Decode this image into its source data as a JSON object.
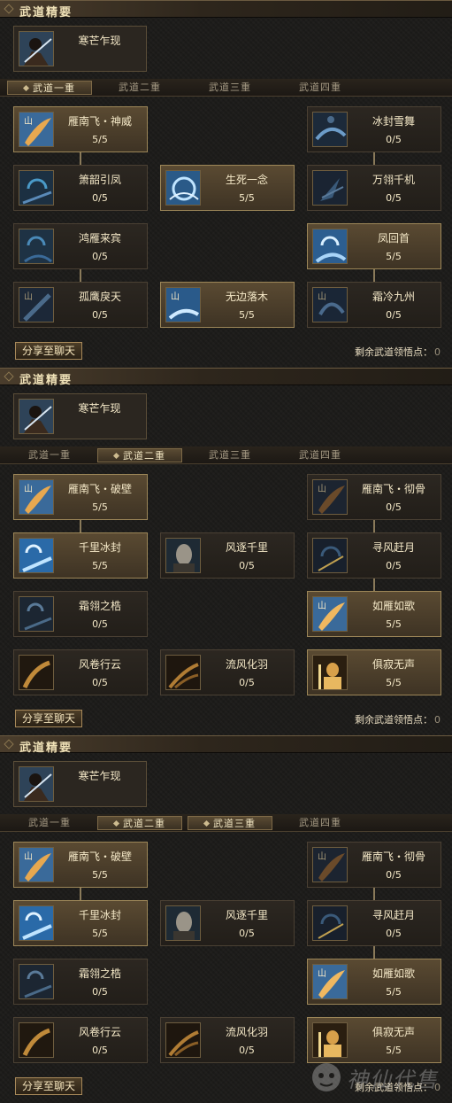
{
  "panels": [
    {
      "section_title": "武道精要",
      "essence": {
        "name": "寒芒乍现",
        "icon": "warrior-portrait-icon"
      },
      "tabs": [
        {
          "label": "武道一重",
          "active": true
        },
        {
          "label": "武道二重",
          "active": false
        },
        {
          "label": "武道三重",
          "active": false
        },
        {
          "label": "武道四重",
          "active": false
        }
      ],
      "skills": [
        {
          "name": "雁南飞・神威",
          "level": "5/5",
          "active": true,
          "icon": "flying-goose-icon"
        },
        {
          "name": "冰封雪舞",
          "level": "0/5",
          "active": false,
          "icon": "ice-storm-icon"
        },
        {
          "name": "箫韶引凤",
          "level": "0/5",
          "active": false,
          "icon": "phoenix-spiral-icon"
        },
        {
          "name": "生死一念",
          "level": "5/5",
          "active": true,
          "icon": "ice-vortex-icon"
        },
        {
          "name": "万翎千机",
          "level": "0/5",
          "active": false,
          "icon": "feather-storm-icon"
        },
        {
          "name": "鸿雁来宾",
          "level": "0/5",
          "active": false,
          "icon": "wild-goose-icon"
        },
        {
          "name": "凤回首",
          "level": "5/5",
          "active": true,
          "icon": "phoenix-return-icon"
        },
        {
          "name": "孤鹰戾天",
          "level": "0/5",
          "active": false,
          "icon": "lone-eagle-icon"
        },
        {
          "name": "无边落木",
          "level": "5/5",
          "active": true,
          "icon": "falling-leaves-icon"
        },
        {
          "name": "霜冷九州",
          "level": "0/5",
          "active": false,
          "icon": "frost-realm-icon"
        }
      ],
      "share_label": "分享至聊天",
      "points_label": "剩余武道领悟点：",
      "points_value": "0"
    },
    {
      "section_title": "武道精要",
      "essence": {
        "name": "寒芒乍现",
        "icon": "warrior-portrait-icon"
      },
      "tabs": [
        {
          "label": "武道一重",
          "active": false
        },
        {
          "label": "武道二重",
          "active": true
        },
        {
          "label": "武道三重",
          "active": false
        },
        {
          "label": "武道四重",
          "active": false
        }
      ],
      "skills": [
        {
          "name": "雁南飞・破壁",
          "level": "5/5",
          "active": true,
          "icon": "flying-goose-icon"
        },
        {
          "name": "雁南飞・彻骨",
          "level": "0/5",
          "active": false,
          "icon": "flying-goose-icon"
        },
        {
          "name": "千里冰封",
          "level": "5/5",
          "active": true,
          "icon": "ice-seal-icon"
        },
        {
          "name": "风逐千里",
          "level": "0/5",
          "active": false,
          "icon": "wind-chaser-portrait-icon"
        },
        {
          "name": "寻风赶月",
          "level": "0/5",
          "active": false,
          "icon": "moon-chase-icon"
        },
        {
          "name": "霜翎之梏",
          "level": "0/5",
          "active": false,
          "icon": "frost-feather-icon"
        },
        {
          "name": "如雁如歌",
          "level": "5/5",
          "active": true,
          "icon": "goose-song-icon"
        },
        {
          "name": "风卷行云",
          "level": "0/5",
          "active": false,
          "icon": "wind-cloud-icon"
        },
        {
          "name": "流风化羽",
          "level": "0/5",
          "active": false,
          "icon": "wind-feather-icon"
        },
        {
          "name": "俱寂无声",
          "level": "5/5",
          "active": true,
          "icon": "silent-warrior-icon"
        }
      ],
      "share_label": "分享至聊天",
      "points_label": "剩余武道领悟点：",
      "points_value": "0"
    },
    {
      "section_title": "武道精要",
      "essence": {
        "name": "寒芒乍现",
        "icon": "warrior-portrait-icon"
      },
      "tabs": [
        {
          "label": "武道一重",
          "active": false
        },
        {
          "label": "武道二重",
          "active": true
        },
        {
          "label": "武道三重",
          "active": true
        },
        {
          "label": "武道四重",
          "active": false
        }
      ],
      "skills": [
        {
          "name": "雁南飞・破壁",
          "level": "5/5",
          "active": true,
          "icon": "flying-goose-icon"
        },
        {
          "name": "雁南飞・彻骨",
          "level": "0/5",
          "active": false,
          "icon": "flying-goose-icon"
        },
        {
          "name": "千里冰封",
          "level": "5/5",
          "active": true,
          "icon": "ice-seal-icon"
        },
        {
          "name": "风逐千里",
          "level": "0/5",
          "active": false,
          "icon": "wind-chaser-portrait-icon"
        },
        {
          "name": "寻风赶月",
          "level": "0/5",
          "active": false,
          "icon": "moon-chase-icon"
        },
        {
          "name": "霜翎之梏",
          "level": "0/5",
          "active": false,
          "icon": "frost-feather-icon"
        },
        {
          "name": "如雁如歌",
          "level": "5/5",
          "active": true,
          "icon": "goose-song-icon"
        },
        {
          "name": "风卷行云",
          "level": "0/5",
          "active": false,
          "icon": "wind-cloud-icon"
        },
        {
          "name": "流风化羽",
          "level": "0/5",
          "active": false,
          "icon": "wind-feather-icon"
        },
        {
          "name": "俱寂无声",
          "level": "5/5",
          "active": true,
          "icon": "silent-warrior-icon"
        }
      ],
      "share_label": "分享至聊天",
      "points_label": "剩余武道领悟点：",
      "points_value": "0"
    }
  ],
  "watermark": {
    "text": "神仙代售",
    "icon": "mascot-logo-icon"
  },
  "colors": {
    "gold_text": "#f5e9c8",
    "active_card": "#5a4a32",
    "inactive_card": "#2c2721",
    "ice_blue": "#3a8fd8",
    "amber": "#c08a3a"
  }
}
